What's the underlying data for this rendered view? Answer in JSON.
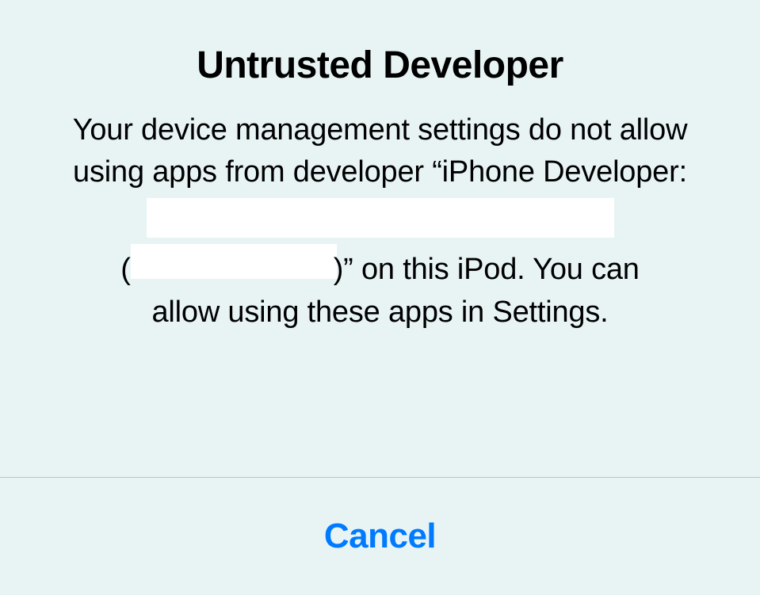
{
  "dialog": {
    "title": "Untrusted Developer",
    "message_line1": "Your device management settings do not allow using apps from developer “iPhone Developer:",
    "message_line3_suffix": ")” on this iPod. You can",
    "message_line4": "allow using these apps in Settings.",
    "open_paren": "(",
    "cancel_label": "Cancel"
  }
}
